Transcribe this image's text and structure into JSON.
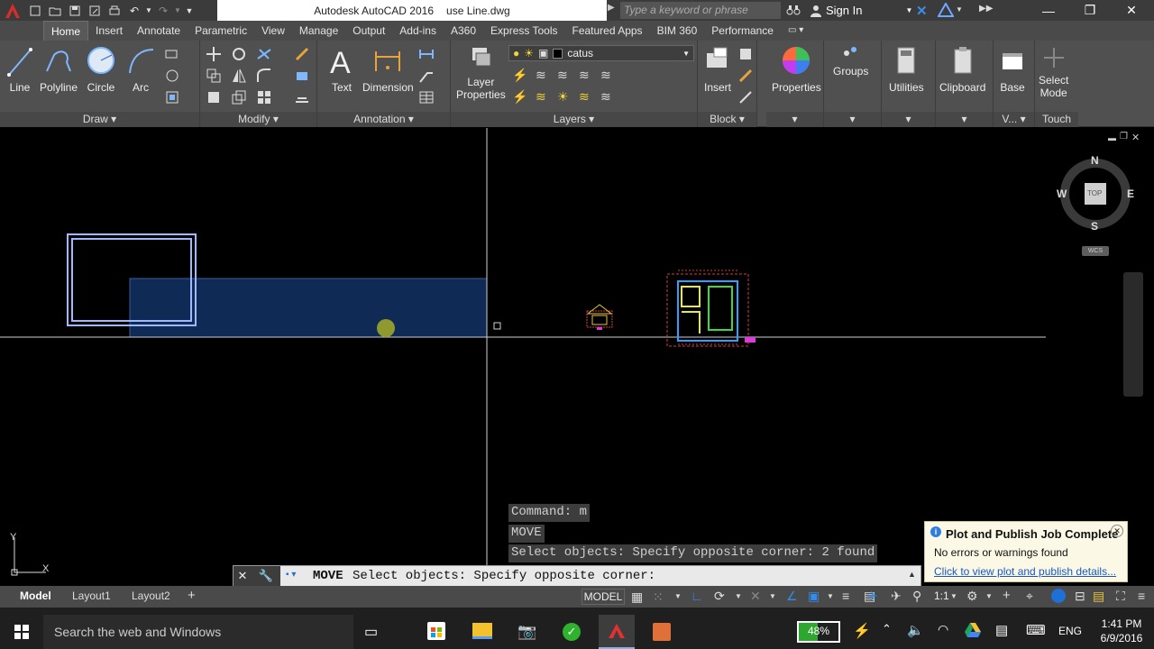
{
  "titlebar": {
    "app": "Autodesk AutoCAD 2016",
    "file": "use Line.dwg",
    "search_placeholder": "Type a keyword or phrase",
    "signin": "Sign In"
  },
  "tabs": [
    "Home",
    "Insert",
    "Annotate",
    "Parametric",
    "View",
    "Manage",
    "Output",
    "Add-ins",
    "A360",
    "Express Tools",
    "Featured Apps",
    "BIM 360",
    "Performance"
  ],
  "ribbon": {
    "draw": {
      "line": "Line",
      "polyline": "Polyline",
      "circle": "Circle",
      "arc": "Arc",
      "footer": "Draw"
    },
    "modify": {
      "footer": "Modify"
    },
    "annotation": {
      "text": "Text",
      "dimension": "Dimension",
      "footer": "Annotation"
    },
    "layers": {
      "layer_properties_1": "Layer",
      "layer_properties_2": "Properties",
      "current_layer": "catus",
      "footer": "Layers"
    },
    "block": {
      "insert": "Insert",
      "footer": "Block"
    },
    "properties": "Properties",
    "groups": "Groups",
    "utilities": "Utilities",
    "clipboard": "Clipboard",
    "base": "Base",
    "view_footer": "V...",
    "select_mode_1": "Select",
    "select_mode_2": "Mode",
    "touch_footer": "Touch"
  },
  "viewcube": {
    "n": "N",
    "s": "S",
    "e": "E",
    "w": "W",
    "top": "TOP",
    "wcs": "WCS"
  },
  "ucs": {
    "x": "X",
    "y": "Y"
  },
  "command_history": [
    "Command: m",
    "MOVE",
    "Select objects: Specify opposite corner: 2 found"
  ],
  "command_input": {
    "cmd": "MOVE",
    "prompt": "Select objects: Specify opposite corner:"
  },
  "notification": {
    "title": "Plot and Publish Job Complete",
    "message": "No errors or warnings found",
    "link": "Click to view plot and publish details..."
  },
  "layout_tabs": [
    "Model",
    "Layout1",
    "Layout2"
  ],
  "status": {
    "model": "MODEL",
    "scale": "1:1"
  },
  "taskbar": {
    "search": "Search the web and Windows",
    "battery": "48%",
    "lang": "ENG",
    "time": "1:41 PM",
    "date": "6/9/2016"
  },
  "colors": {
    "accent": "#0078d7",
    "selection_fill": "#0e2a55",
    "selection_border": "#9fb8ff"
  }
}
